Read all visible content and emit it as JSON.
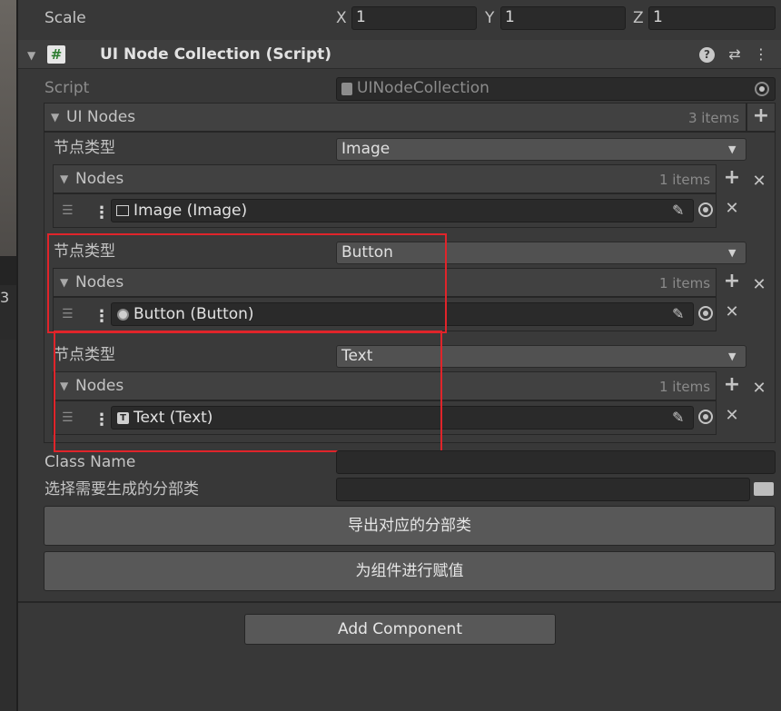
{
  "transform": {
    "scale_label": "Scale",
    "x_label": "X",
    "x_value": "1",
    "y_label": "Y",
    "y_value": "1",
    "z_label": "Z",
    "z_value": "1"
  },
  "left_panel": {
    "value": "3"
  },
  "component": {
    "title": "UI Node Collection (Script)",
    "icons": [
      "help-icon",
      "presets-icon",
      "kebab-menu-icon"
    ]
  },
  "script_row": {
    "label": "Script",
    "value": "UINodeCollection"
  },
  "ui_nodes": {
    "label": "UI Nodes",
    "count": "3 items",
    "entries": [
      {
        "type_label": "节点类型",
        "type_value": "Image",
        "nodes_label": "Nodes",
        "nodes_count": "1 items",
        "item_value": "Image (Image)",
        "item_icon": "image-icon"
      },
      {
        "type_label": "节点类型",
        "type_value": "Button",
        "nodes_label": "Nodes",
        "nodes_count": "1 items",
        "item_value": "Button (Button)",
        "item_icon": "button-icon"
      },
      {
        "type_label": "节点类型",
        "type_value": "Text",
        "nodes_label": "Nodes",
        "nodes_count": "1 items",
        "item_value": "Text (Text)",
        "item_icon": "text-icon"
      }
    ]
  },
  "class_name": {
    "label": "Class Name",
    "value": ""
  },
  "partial_class": {
    "label": "选择需要生成的分部类",
    "value": ""
  },
  "buttons": {
    "export": "导出对应的分部类",
    "assign": "为组件进行赋值",
    "add_component": "Add Component"
  },
  "colors": {
    "background": "#383838",
    "highlight_box": "#e0242a",
    "field": "#2a2a2a",
    "button": "#585858"
  }
}
